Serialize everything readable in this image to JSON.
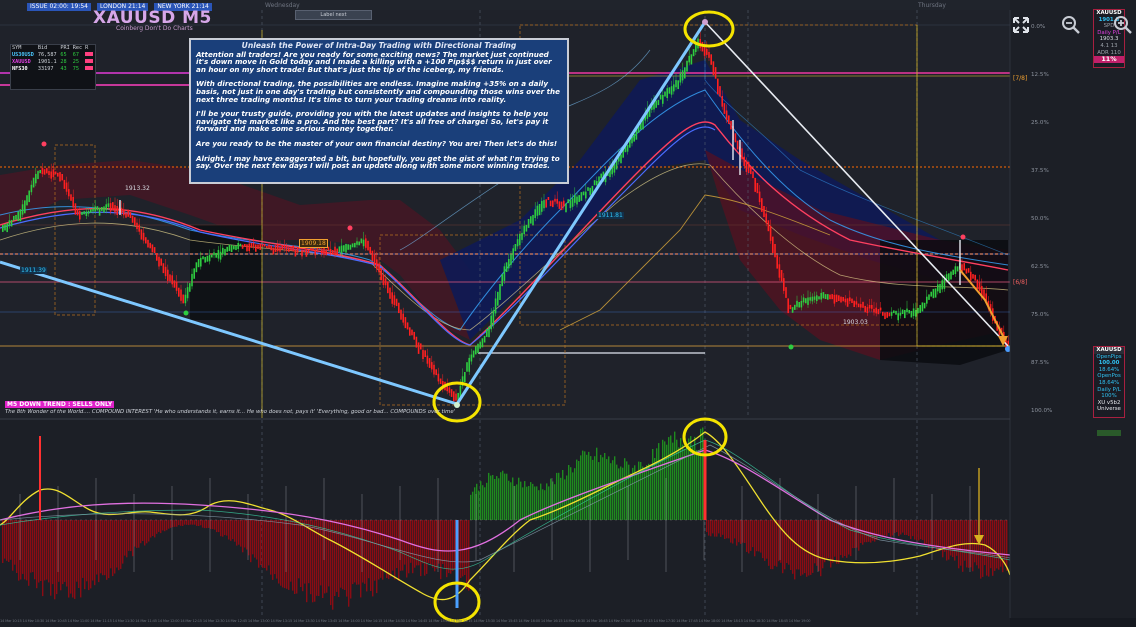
{
  "chart": {
    "symbol_title": "XAUUSD M5",
    "subtitle": "Coinberg Don't Do Charts",
    "sessions": [
      {
        "label": "ISSUE 02:00: 19:54",
        "color": "#2a55b8"
      },
      {
        "label": "LONDON 21:14",
        "color": "#2a55b8"
      },
      {
        "label": "NEW YORK 21:14",
        "color": "#2a55b8"
      }
    ],
    "days": [
      "Wednesday",
      "Thursday"
    ],
    "day_button": "Label next"
  },
  "stats_panel": {
    "header": [
      "SYM",
      "Bid",
      "PRI",
      "Rec",
      "R"
    ],
    "rows": [
      {
        "sym": "US30USD",
        "bid": "76,587",
        "a": "65",
        "b": "67",
        "c": "",
        "color": "#e6e8ec"
      },
      {
        "sym": "XAUUSD",
        "bid": "1901.1",
        "a": "28",
        "b": "25",
        "c": "",
        "color": "#e6e8ec"
      },
      {
        "sym": "NFS30",
        "bid": "33197",
        "a": "43",
        "b": "75",
        "c": "",
        "color": "#e6e8ec"
      }
    ]
  },
  "textbox": {
    "title": "Unleash the Power of Intra-Day Trading with Directional Trading",
    "paragraphs": [
      "Attention all traders! Are you ready for some exciting news? The market just continued it's down move in Gold today and I made a killing with a +100 Pip$$$ return in just over an hour on my short trade! But that's just the tip of the iceberg, my friends.",
      "With directional trading, the possibilities are endless. Imagine making +35% on a daily basis, not just in one day's trading but consistently and compounding those wins over the next three trading months! It's time to turn your trading dreams into reality.",
      "I'll be your trusty guide, providing you with the latest updates and insights to help you navigate the market like a pro. And the best part? It's all free of charge! So, let's pay it forward and make some serious money together.",
      "Are you ready to be the master of your own financial destiny? You are! Then let's do this!",
      "Alright, I may have exaggerated a bit, but hopefully, you get the gist of what I'm trying to say. Over the next few days I will post an update along with some more winning trades."
    ]
  },
  "trend_label": "M5  DOWN TREND : SELLS ONLY",
  "quote": "The 8th Wonder of the World.... COMPOUND INTEREST  'He who understands it, earns it... He who does not, pays it'       'Everything, good or bad... COMPOUNDS over time'",
  "price_labels": [
    {
      "text": "1913.32",
      "color": "#d9dde4",
      "bg": "none"
    },
    {
      "text": "1909.18",
      "color": "#f0a030",
      "bg": "#3a2a10"
    },
    {
      "text": "1911.39",
      "color": "#30c0f0",
      "bg": "#12304a"
    },
    {
      "text": "1911.81",
      "color": "#30c0f0",
      "bg": "#12304a"
    },
    {
      "text": "1903.03",
      "color": "#d9dde4",
      "bg": "none"
    },
    {
      "text": "[7/8]",
      "color": "#f0a030",
      "bg": "none"
    },
    {
      "text": "[6/8]",
      "color": "#f06060",
      "bg": "none"
    }
  ],
  "fib_levels": [
    "0.0%",
    "12.5%",
    "25.0%",
    "37.5%",
    "50.0%",
    "62.5%",
    "75.0%",
    "87.5%",
    "100.0%"
  ],
  "right_boxes": {
    "top": {
      "symbol": "XAUUSD",
      "price": "1901.3",
      "label": "SPD",
      "pl_label": "Daily P/L",
      "pl_value": "1903.3",
      "rows": [
        "4.1  13",
        "ADR  110"
      ],
      "percent": "11%"
    },
    "bottom": {
      "symbol": "XAUUSD",
      "open_label": "OpenPips",
      "open_value": "100.00",
      "value2": "18.64%",
      "pos_label": "OpenPos",
      "pos_value": "18.64%",
      "pl_label": "Daily P/L",
      "pl_value": "100%",
      "footer1": "XU v5b2",
      "footer2": "Universe"
    }
  },
  "oscillator": {
    "corner_badge": ""
  },
  "time_axis_text": "14 Mar 10:15   14 Mar 10:30   14 Mar 10:45   14 Mar 11:00   14 Mar 11:15   14 Mar 11:30   14 Mar 11:45   14 Mar 12:00   14 Mar 12:15   14 Mar 12:30   14 Mar 12:45   14 Mar 13:00   14 Mar 13:15   14 Mar 13:30   14 Mar 13:45   14 Mar 14:00   14 Mar 14:15   14 Mar 14:30   14 Mar 14:45   14 Mar 15:00   14 Mar 15:15   14 Mar 15:30   14 Mar 15:45   14 Mar 16:00   14 Mar 16:15   14 Mar 16:30   14 Mar 16:45   14 Mar 17:00   14 Mar 17:15   14 Mar 17:30   14 Mar 17:45   14 Mar 18:00   14 Mar 18:15   14 Mar 18:30   14 Mar 18:45   14 Mar 19:00",
  "icons": [
    "fullscreen-icon",
    "zoom-out-icon",
    "zoom-in-icon"
  ],
  "colors": {
    "bull": "#2ecc40",
    "bear": "#ff2020",
    "highlight": "#f5e400",
    "trendline": "#7ec8ff"
  }
}
